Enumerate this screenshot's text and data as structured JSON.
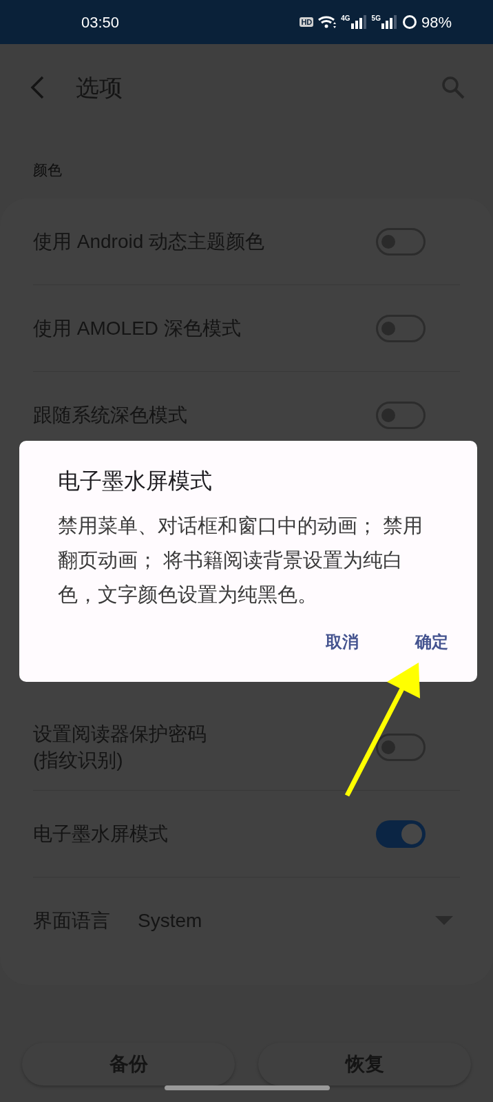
{
  "status_bar": {
    "time": "03:50",
    "indicators": [
      "HD",
      "4G",
      "5G"
    ],
    "battery": "98%"
  },
  "header": {
    "title": "选项"
  },
  "section_label": "颜色",
  "settings": [
    {
      "kind": "switch",
      "label": "使用 Android 动态主题颜色",
      "on": false
    },
    {
      "kind": "switch",
      "label": "使用 AMOLED 深色模式",
      "on": false
    },
    {
      "kind": "switch",
      "label": "跟随系统深色模式",
      "on": false
    },
    {
      "kind": "switch",
      "label": "设置阅读器保护密码\n(指纹识别)",
      "on": false
    },
    {
      "kind": "switch",
      "label": "电子墨水屏模式",
      "on": true
    },
    {
      "kind": "dropdown",
      "label": "界面语言",
      "value": "System"
    }
  ],
  "buttons": [
    "备份",
    "恢复"
  ],
  "dialog": {
    "title": "电子墨水屏模式",
    "message": "禁用菜单、对话框和窗口中的动画； 禁用翻页动画； 将书籍阅读背景设置为纯白色，文字颜色设置为纯黑色。",
    "buttons": [
      "取消",
      "确定"
    ]
  }
}
